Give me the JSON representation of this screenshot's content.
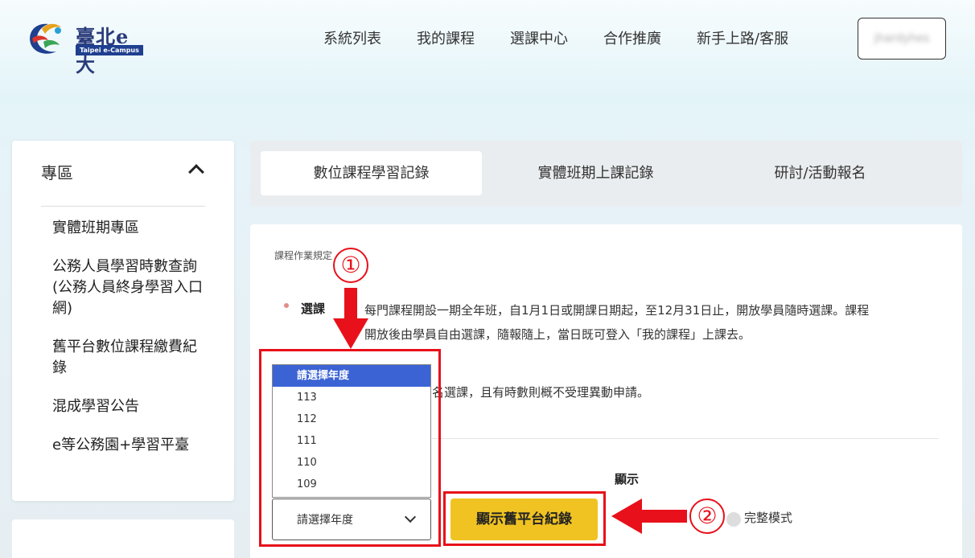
{
  "header": {
    "logo_text": "臺北e大",
    "logo_sub": "Taipei e-Campus",
    "nav": [
      "系統列表",
      "我的課程",
      "選課中心",
      "合作推廣",
      "新手上路/客服"
    ],
    "user_name": "jhardyhes"
  },
  "sidebar": {
    "title": "專區",
    "items": [
      "實體班期專區",
      "公務人員學習時數查詢\n(公務人員終身學習入口網)",
      "舊平台數位課程繳費紀錄",
      "混成學習公告",
      "e等公務園+學習平臺"
    ]
  },
  "tabs": [
    "數位課程學習記錄",
    "實體班期上課記錄",
    "研討/活動報名"
  ],
  "rules": {
    "title": "課程作業規定",
    "label": "選課",
    "text": "每門課程開設一期全年班，自1月1日或開課日期起，至12月31日止，開放學員隨時選課。課程開放後由學員自由選課，隨報隨上，當日既可登入「我的課程」上課去。",
    "text2": "名選課，且有時數則概不受理異動申請。"
  },
  "filters": {
    "display_label": "顯示",
    "mode_label": "完整模式",
    "year_options": [
      "請選擇年度",
      "113",
      "112",
      "111",
      "110",
      "109"
    ],
    "year_selected": "請選擇年度",
    "show_button": "顯示舊平台紀錄"
  },
  "annotations": {
    "step1": "①",
    "step2": "②",
    "color": "#e8101a"
  }
}
